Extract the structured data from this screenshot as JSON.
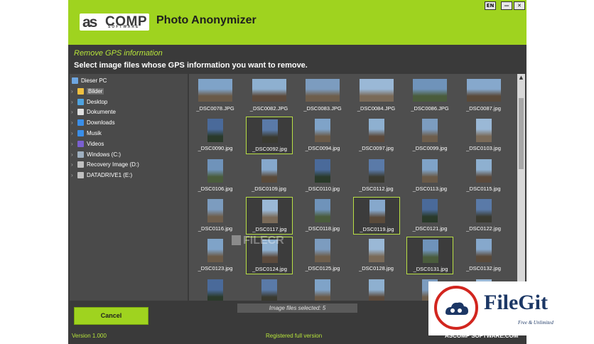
{
  "window": {
    "app_title": "Photo Anonymizer",
    "logo": {
      "brand_main": "as",
      "brand_comp": "COMP",
      "brand_sub": "SOFTWARE"
    },
    "controls": {
      "language": "EN",
      "minimize": "—",
      "close": "✕"
    }
  },
  "step": {
    "title": "Remove GPS information",
    "instruction": "Select image files whose GPS information you want to remove."
  },
  "tree": {
    "items": [
      {
        "label": "Dieser PC",
        "icon": "computer-icon"
      },
      {
        "label": "Bilder",
        "icon": "pictures-folder-icon",
        "selected": true
      },
      {
        "label": "Desktop",
        "icon": "desktop-folder-icon"
      },
      {
        "label": "Dokumente",
        "icon": "documents-folder-icon"
      },
      {
        "label": "Downloads",
        "icon": "downloads-folder-icon"
      },
      {
        "label": "Musik",
        "icon": "music-folder-icon"
      },
      {
        "label": "Videos",
        "icon": "videos-folder-icon"
      },
      {
        "label": "Windows  (C:)",
        "icon": "drive-icon"
      },
      {
        "label": "Recovery Image (D:)",
        "icon": "drive-icon"
      },
      {
        "label": "DATADRIVE1 (E:)",
        "icon": "drive-icon"
      }
    ]
  },
  "grid": {
    "files": [
      {
        "name": "_DSC0078.JPG",
        "selected": false
      },
      {
        "name": "_DSC0082.JPG",
        "selected": false
      },
      {
        "name": "_DSC0083.JPG",
        "selected": false
      },
      {
        "name": "_DSC0084.JPG",
        "selected": false
      },
      {
        "name": "_DSC0086.JPG",
        "selected": false
      },
      {
        "name": "_DSC0087.jpg",
        "selected": false
      },
      {
        "name": "_DSC0090.jpg",
        "selected": false
      },
      {
        "name": "_DSC0092.jpg",
        "selected": true
      },
      {
        "name": "_DSC0094.jpg",
        "selected": false
      },
      {
        "name": "_DSC0097.jpg",
        "selected": false
      },
      {
        "name": "_DSC0099.jpg",
        "selected": false
      },
      {
        "name": "_DSC0103.jpg",
        "selected": false
      },
      {
        "name": "_DSC0106.jpg",
        "selected": false
      },
      {
        "name": "_DSC0109.jpg",
        "selected": false
      },
      {
        "name": "_DSC0110.jpg",
        "selected": false
      },
      {
        "name": "_DSC0112.jpg",
        "selected": false
      },
      {
        "name": "_DSC0113.jpg",
        "selected": false
      },
      {
        "name": "_DSC0115.jpg",
        "selected": false
      },
      {
        "name": "_DSC0116.jpg",
        "selected": false
      },
      {
        "name": "_DSC0117.jpg",
        "selected": true
      },
      {
        "name": "_DSC0118.jpg",
        "selected": false
      },
      {
        "name": "_DSC0119.jpg",
        "selected": true
      },
      {
        "name": "_DSC0121.jpg",
        "selected": false
      },
      {
        "name": "_DSC0122.jpg",
        "selected": false
      },
      {
        "name": "_DSC0123.jpg",
        "selected": false
      },
      {
        "name": "_DSC0124.jpg",
        "selected": true
      },
      {
        "name": "_DSC0125.jpg",
        "selected": false
      },
      {
        "name": "_DSC0128.jpg",
        "selected": false
      },
      {
        "name": "_DSC0131.jpg",
        "selected": true
      },
      {
        "name": "_DSC0132.jpg",
        "selected": false
      },
      {
        "name": "",
        "selected": false
      },
      {
        "name": "",
        "selected": false
      },
      {
        "name": "",
        "selected": false
      },
      {
        "name": "",
        "selected": false
      },
      {
        "name": "",
        "selected": false
      },
      {
        "name": "",
        "selected": false
      }
    ]
  },
  "footer": {
    "cancel_label": "Cancel",
    "selection_status": "Image files selected: 5",
    "version": "Version 1.000",
    "license": "Registered full version",
    "ascomp_url": "ASCOMP SOFTWARE.COM"
  },
  "watermarks": {
    "filecr": "FILECR",
    "filegit_name": "FileGit",
    "filegit_tagline": "Free & Unlimited"
  },
  "colors": {
    "accent": "#9fd31f",
    "window_bg": "#3a3a3a",
    "accent_text": "#b8e63a"
  }
}
